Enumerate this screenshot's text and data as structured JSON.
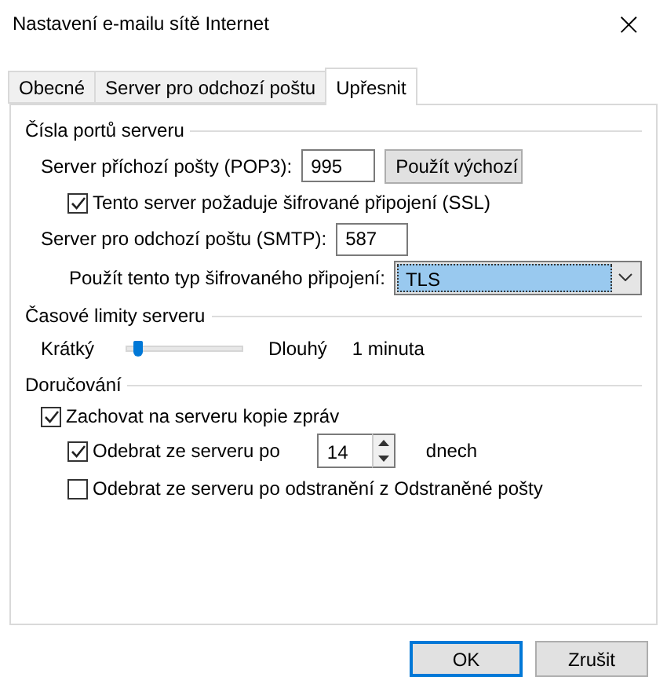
{
  "window": {
    "title": "Nastavení e-mailu sítě Internet",
    "close": "×"
  },
  "tabs": [
    {
      "label": "Obecné",
      "selected": false
    },
    {
      "label": "Server pro odchozí poštu",
      "selected": false
    },
    {
      "label": "Upřesnit",
      "selected": true
    }
  ],
  "ports": {
    "heading": "Čísla portů serveru",
    "incoming_label": "Server příchozí pošty (POP3):",
    "incoming_value": "995",
    "default_button": "Použít výchozí",
    "ssl": {
      "label": "Tento server požaduje šifrované připojení (SSL)",
      "checked": true
    },
    "outgoing_label": "Server pro odchozí poštu (SMTP):",
    "outgoing_value": "587",
    "encryption_label": "Použít tento typ šifrovaného připojení:",
    "encryption_value": "TLS"
  },
  "timeouts": {
    "heading": "Časové limity serveru",
    "min_label": "Krátký",
    "level": 0.1,
    "max_label": "Dlouhý",
    "reading": "1 minuta"
  },
  "delivery": {
    "heading": "Doručování",
    "keep_copy": {
      "label": "Zachovat na serveru kopie zpráv",
      "checked": true
    },
    "remove_after": {
      "label": "Odebrat ze serveru po",
      "checked": true,
      "value": "14",
      "unit": "dnech"
    },
    "remove_deleted": {
      "label": "Odebrat ze serveru po odstranění z Odstraněné pošty",
      "checked": false
    }
  },
  "buttons": [
    {
      "label": "OK",
      "default": true
    },
    {
      "label": "Zrušit",
      "default": false
    }
  ]
}
